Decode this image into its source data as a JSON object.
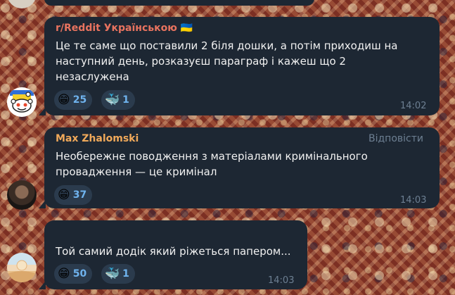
{
  "messages": [
    {
      "sender": "r/Reddit Українською",
      "sender_flag": "🇺🇦",
      "sender_color": "#e8735f",
      "lines": [
        "Це те саме що поставили 2 біля дошки, а потім приходиш на",
        "наступний день, розказуєш параграф і кажеш що 2",
        "незаслужена"
      ],
      "reactions": [
        {
          "emoji": "😁",
          "icon": "grin-emoji-icon",
          "count": "25"
        },
        {
          "emoji": "🐳",
          "icon": "whale-emoji-icon",
          "count": "1"
        }
      ],
      "time": "14:02"
    },
    {
      "sender": "Max Zhalomski",
      "sender_color": "#f0a95a",
      "reply_label": "Відповісти",
      "lines": [
        "Необережне поводження з матеріалами кримінального",
        "провадження — це кримінал"
      ],
      "reactions": [
        {
          "emoji": "😁",
          "icon": "grin-emoji-icon",
          "count": "37"
        }
      ],
      "time": "14:03"
    },
    {
      "lines": [
        "Той самий додік який ріжеться папером..."
      ],
      "reactions": [
        {
          "emoji": "😁",
          "icon": "grin-emoji-icon",
          "count": "50"
        },
        {
          "emoji": "🐳",
          "icon": "whale-emoji-icon",
          "count": "1"
        }
      ],
      "time": "14:03"
    }
  ],
  "colors": {
    "bubble": "#1d2733",
    "reaction_bg": "#2b3b4d",
    "reaction_count": "#6fb3ee",
    "meta": "#6d7f92"
  }
}
